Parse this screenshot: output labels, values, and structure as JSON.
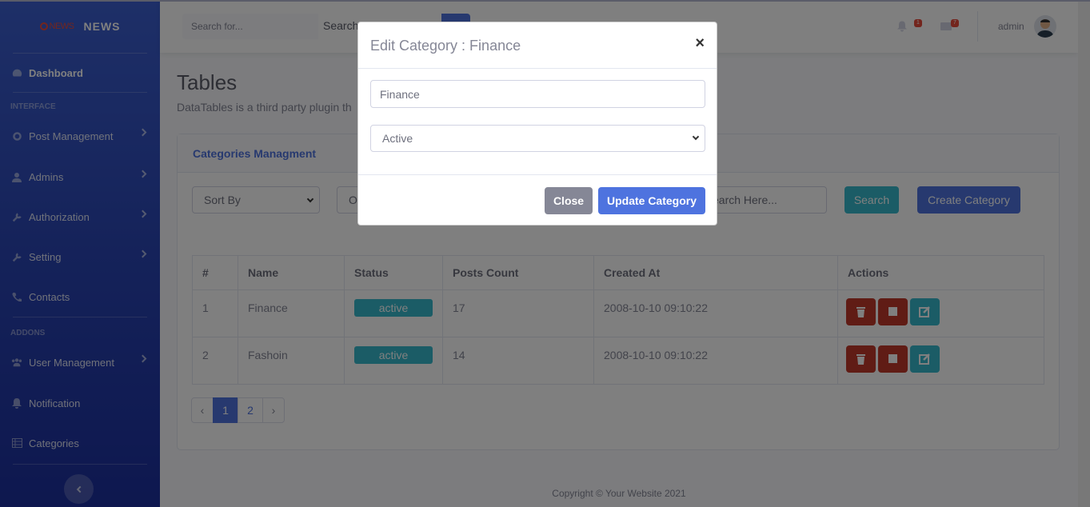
{
  "brand": {
    "logo_text": "NEWS",
    "name": "NEWS"
  },
  "sidebar": {
    "dashboard": "Dashboard",
    "heading_interface": "INTERFACE",
    "post_management": "Post Management",
    "admins": "Admins",
    "authorization": "Authorization",
    "setting": "Setting",
    "contacts": "Contacts",
    "heading_addons": "ADDONS",
    "user_management": "User Management",
    "notification": "Notification",
    "categories": "Categories"
  },
  "topbar": {
    "search_placeholder": "Search for...",
    "search_label": "Search",
    "alerts_count": "1",
    "messages_count": "7",
    "user_name": "admin"
  },
  "page": {
    "title": "Tables",
    "description": "DataTables is a third party plugin th"
  },
  "card": {
    "title": "Categories Managment",
    "sort_by": "Sort By",
    "order_by": "O",
    "search_placeholder": "earch Here...",
    "search_button": "Search",
    "create_button": "Create Category"
  },
  "table": {
    "headers": [
      "#",
      "Name",
      "Status",
      "Posts Count",
      "Created At",
      "Actions"
    ],
    "rows": [
      {
        "id": "1",
        "name": "Finance",
        "status": "active",
        "posts": "17",
        "created": "2008-10-10 09:10:22"
      },
      {
        "id": "2",
        "name": "Fashoin",
        "status": "active",
        "posts": "14",
        "created": "2008-10-10 09:10:22"
      }
    ]
  },
  "pagination": {
    "prev": "‹",
    "pages": [
      "1",
      "2"
    ],
    "next": "›"
  },
  "footer": "Copyright © Your Website 2021",
  "modal": {
    "title": "Edit Category : Finance",
    "close_x": "×",
    "name_value": "Finance",
    "status_value": "Active",
    "close_button": "Close",
    "update_button": "Update Category"
  },
  "colors": {
    "primary": "#4e73df",
    "danger": "#e74a3b",
    "info": "#36b9cc",
    "secondary": "#858796"
  }
}
